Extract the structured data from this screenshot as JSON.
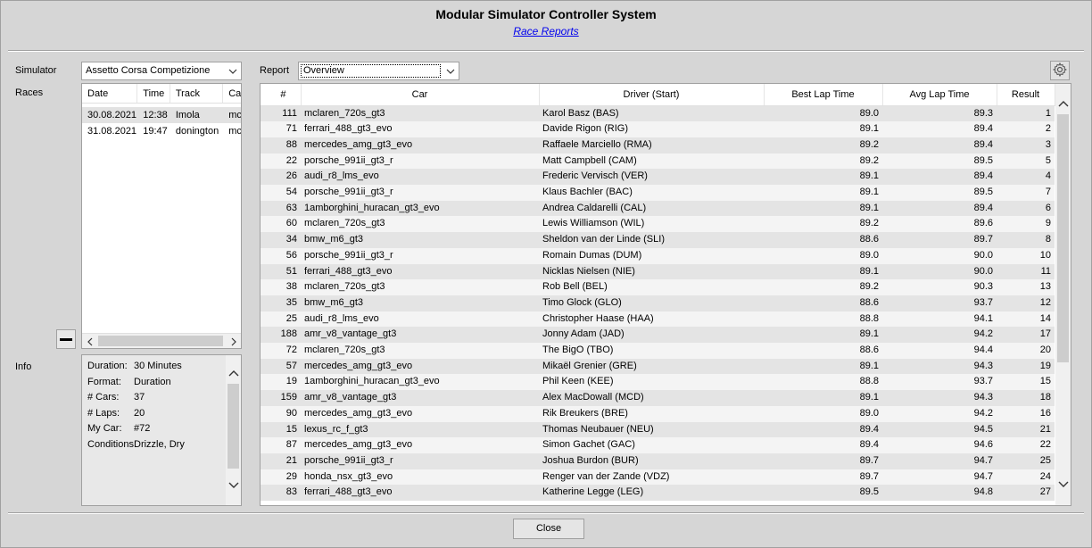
{
  "window": {
    "title": "Modular Simulator Controller System",
    "subtitle_link": "Race Reports"
  },
  "simulator": {
    "label": "Simulator",
    "value": "Assetto Corsa Competizione"
  },
  "report": {
    "label": "Report",
    "value": "Overview"
  },
  "races": {
    "label": "Races",
    "columns": [
      "Date",
      "Time",
      "Track",
      "Ca"
    ],
    "rows": [
      [
        "30.08.2021",
        "12:38",
        "Imola",
        "mc"
      ],
      [
        "31.08.2021",
        "19:47",
        "donington",
        "mc"
      ]
    ]
  },
  "info": {
    "label": "Info",
    "lines": [
      {
        "k": "Duration:",
        "v": "30 Minutes"
      },
      {
        "k": "Format:",
        "v": "Duration"
      },
      {
        "k": "# Cars:",
        "v": "37"
      },
      {
        "k": "# Laps:",
        "v": "20"
      },
      {
        "k": "My Car:",
        "v": "#72"
      },
      {
        "k": "Conditions:",
        "v": "Drizzle, Dry"
      }
    ]
  },
  "table": {
    "columns": [
      "#",
      "Car",
      "Driver (Start)",
      "Best Lap Time",
      "Avg Lap Time",
      "Result"
    ],
    "rows": [
      [
        "111",
        "mclaren_720s_gt3",
        "Karol Basz (BAS)",
        "89.0",
        "89.3",
        "1"
      ],
      [
        "71",
        "ferrari_488_gt3_evo",
        "Davide Rigon (RIG)",
        "89.1",
        "89.4",
        "2"
      ],
      [
        "88",
        "mercedes_amg_gt3_evo",
        "Raffaele Marciello (RMA)",
        "89.2",
        "89.4",
        "3"
      ],
      [
        "22",
        "porsche_991ii_gt3_r",
        "Matt Campbell (CAM)",
        "89.2",
        "89.5",
        "5"
      ],
      [
        "26",
        "audi_r8_lms_evo",
        "Frederic Vervisch (VER)",
        "89.1",
        "89.4",
        "4"
      ],
      [
        "54",
        "porsche_991ii_gt3_r",
        "Klaus Bachler (BAC)",
        "89.1",
        "89.5",
        "7"
      ],
      [
        "63",
        "1amborghini_huracan_gt3_evo",
        "Andrea Caldarelli (CAL)",
        "89.1",
        "89.4",
        "6"
      ],
      [
        "60",
        "mclaren_720s_gt3",
        "Lewis Williamson (WIL)",
        "89.2",
        "89.6",
        "9"
      ],
      [
        "34",
        "bmw_m6_gt3",
        "Sheldon van der Linde (SLI)",
        "88.6",
        "89.7",
        "8"
      ],
      [
        "56",
        "porsche_991ii_gt3_r",
        "Romain Dumas (DUM)",
        "89.0",
        "90.0",
        "10"
      ],
      [
        "51",
        "ferrari_488_gt3_evo",
        "Nicklas Nielsen (NIE)",
        "89.1",
        "90.0",
        "11"
      ],
      [
        "38",
        "mclaren_720s_gt3",
        "Rob Bell (BEL)",
        "89.2",
        "90.3",
        "13"
      ],
      [
        "35",
        "bmw_m6_gt3",
        "Timo Glock (GLO)",
        "88.6",
        "93.7",
        "12"
      ],
      [
        "25",
        "audi_r8_lms_evo",
        "Christopher Haase (HAA)",
        "88.8",
        "94.1",
        "14"
      ],
      [
        "188",
        "amr_v8_vantage_gt3",
        "Jonny Adam (JAD)",
        "89.1",
        "94.2",
        "17"
      ],
      [
        "72",
        "mclaren_720s_gt3",
        "The BigO (TBO)",
        "88.6",
        "94.4",
        "20"
      ],
      [
        "57",
        "mercedes_amg_gt3_evo",
        "Mikaël Grenier (GRE)",
        "89.1",
        "94.3",
        "19"
      ],
      [
        "19",
        "1amborghini_huracan_gt3_evo",
        "Phil Keen (KEE)",
        "88.8",
        "93.7",
        "15"
      ],
      [
        "159",
        "amr_v8_vantage_gt3",
        "Alex MacDowall (MCD)",
        "89.1",
        "94.3",
        "18"
      ],
      [
        "90",
        "mercedes_amg_gt3_evo",
        "Rik Breukers (BRE)",
        "89.0",
        "94.2",
        "16"
      ],
      [
        "15",
        "lexus_rc_f_gt3",
        "Thomas Neubauer (NEU)",
        "89.4",
        "94.5",
        "21"
      ],
      [
        "87",
        "mercedes_amg_gt3_evo",
        "Simon Gachet (GAC)",
        "89.4",
        "94.6",
        "22"
      ],
      [
        "21",
        "porsche_991ii_gt3_r",
        "Joshua Burdon (BUR)",
        "89.7",
        "94.7",
        "25"
      ],
      [
        "29",
        "honda_nsx_gt3_evo",
        "Renger van der Zande (VDZ)",
        "89.7",
        "94.7",
        "24"
      ],
      [
        "83",
        "ferrari_488_gt3_evo",
        "Katherine Legge (LEG)",
        "89.5",
        "94.8",
        "27"
      ]
    ]
  },
  "close_button": "Close",
  "icons": {
    "settings": "gear-icon",
    "remove": "minus-icon",
    "dropdown": "chevron-down-icon"
  }
}
